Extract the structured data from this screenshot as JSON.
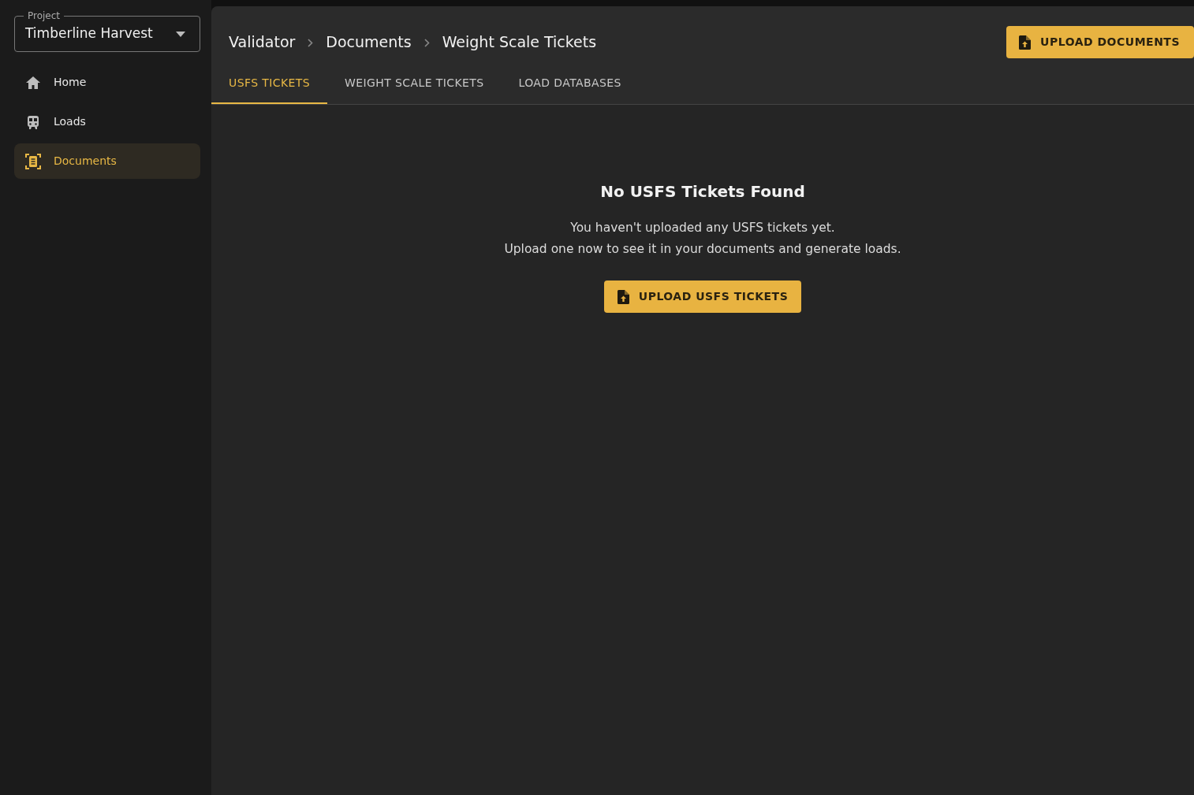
{
  "project_select": {
    "label": "Project",
    "value": "Timberline Harvest"
  },
  "sidebar": {
    "items": [
      {
        "label": "Home",
        "kind": "home",
        "selected": false
      },
      {
        "label": "Loads",
        "kind": "vehicle",
        "selected": false
      },
      {
        "label": "Documents",
        "kind": "document",
        "selected": true
      }
    ]
  },
  "breadcrumb": [
    "Validator",
    "Documents",
    "Weight Scale Tickets"
  ],
  "upload_button": "UPLOAD DOCUMENTS",
  "tabs": [
    {
      "label": "USFS TICKETS",
      "selected": true
    },
    {
      "label": "WEIGHT SCALE TICKETS",
      "selected": false
    },
    {
      "label": "LOAD DATABASES",
      "selected": false
    }
  ],
  "empty_state": {
    "title": "No USFS Tickets Found",
    "lines": [
      "You haven't uploaded any USFS tickets yet.",
      "Upload one now to see it in your documents and generate loads."
    ],
    "button": "UPLOAD USFS TICKETS"
  }
}
